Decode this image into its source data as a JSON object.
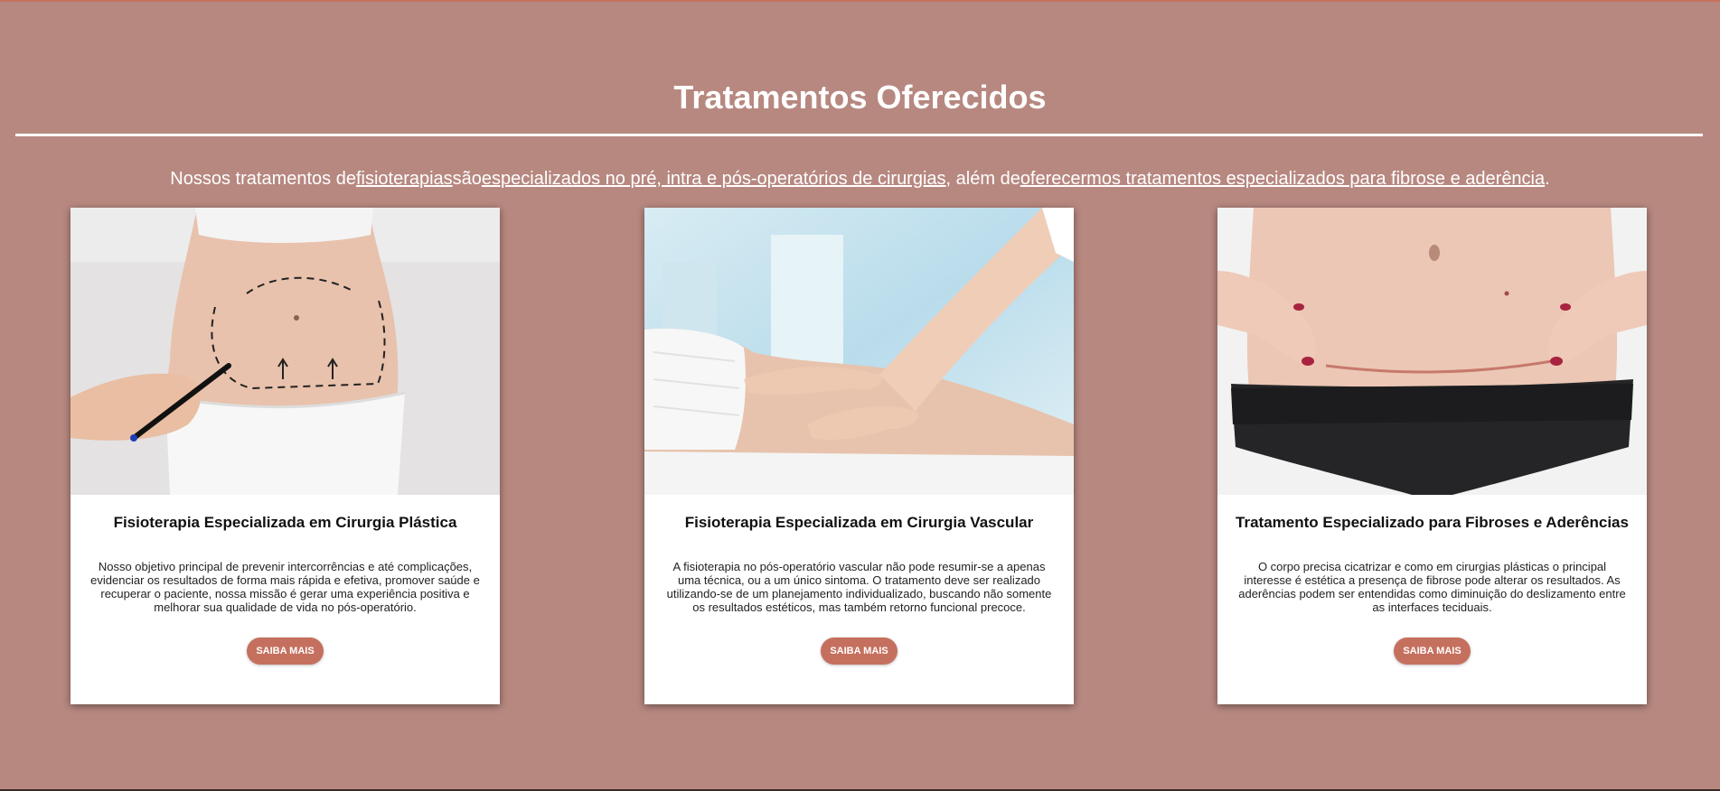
{
  "section": {
    "title": "Tratamentos Oferecidos",
    "intro": {
      "part1": "Nossos tratamentos de",
      "link1": "fisioterapias",
      "part2": "são",
      "link2": "especializados no pré, intra e pós-operatórios de cirurgias",
      "part3": ", além de",
      "link3": "oferecermos tratamentos especializados para fibrose e aderência",
      "part4": "."
    }
  },
  "cards": [
    {
      "image_name": "plastic-surgery-photo",
      "title": "Fisioterapia Especializada em Cirurgia Plástica",
      "text": "Nosso objetivo principal de prevenir intercorrências e até complicações, evidenciar os resultados de forma mais rápida e efetiva, promover saúde e recuperar o paciente, nossa missão é gerar uma experiência positiva e melhorar sua qualidade de vida no pós-operatório.",
      "button": "SAIBA MAIS"
    },
    {
      "image_name": "vascular-massage-photo",
      "title": "Fisioterapia Especializada em Cirurgia Vascular",
      "text": "A fisioterapia no pós-operatório vascular não pode resumir-se a apenas uma técnica, ou a um único sintoma. O tratamento deve ser realizado utilizando-se de um planejamento individualizado, buscando não somente os resultados estéticos, mas também retorno funcional precoce.",
      "button": "SAIBA MAIS"
    },
    {
      "image_name": "fibrosis-scar-photo",
      "title": "Tratamento Especializado para Fibroses e Aderências",
      "text": "O corpo precisa cicatrizar e como em cirurgias plásticas o principal interesse é estética a presença de fibrose pode alterar os resultados. As aderências podem ser entendidas como diminuição do deslizamento entre as interfaces teciduais.",
      "button": "SAIBA MAIS"
    }
  ],
  "colors": {
    "background": "#b78880",
    "button": "#c5705e",
    "card": "#ffffff"
  }
}
